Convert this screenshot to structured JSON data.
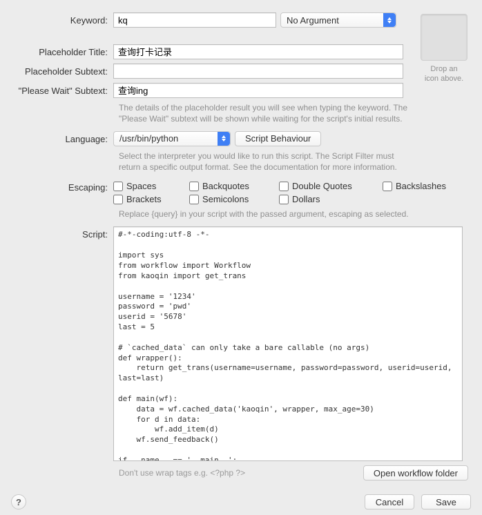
{
  "labels": {
    "keyword": "Keyword:",
    "placeholderTitle": "Placeholder Title:",
    "placeholderSubtext": "Placeholder Subtext:",
    "pleaseWaitSubtext": "\"Please Wait\" Subtext:",
    "language": "Language:",
    "escaping": "Escaping:",
    "script": "Script:"
  },
  "fields": {
    "keyword": "kq",
    "argument": "No Argument",
    "placeholderTitle": "查询打卡记录",
    "placeholderSubtext": "",
    "pleaseWaitSubtext": "查询ing",
    "language": "/usr/bin/python"
  },
  "hints": {
    "placeholder": "The details of the placeholder result you will see when typing the keyword. The \"Please Wait\" subtext will be shown while waiting for the script's initial results.",
    "language": "Select the interpreter you would like to run this script. The Script Filter must return a specific output format. See the documentation for more information.",
    "escaping": "Replace {query} in your script with the passed argument, escaping as selected.",
    "scriptFooter": "Don't use wrap tags e.g. <?php ?>"
  },
  "iconWell": {
    "line1": "Drop an",
    "line2": "icon above."
  },
  "escaping": {
    "spaces": {
      "label": "Spaces",
      "checked": false
    },
    "backquotes": {
      "label": "Backquotes",
      "checked": false
    },
    "doubleQuotes": {
      "label": "Double Quotes",
      "checked": false
    },
    "backslashes": {
      "label": "Backslashes",
      "checked": false
    },
    "brackets": {
      "label": "Brackets",
      "checked": false
    },
    "semicolons": {
      "label": "Semicolons",
      "checked": false
    },
    "dollars": {
      "label": "Dollars",
      "checked": false
    }
  },
  "buttons": {
    "scriptBehaviour": "Script Behaviour",
    "openWorkflowFolder": "Open workflow folder",
    "cancel": "Cancel",
    "save": "Save",
    "help": "?"
  },
  "script": "#-*-coding:utf-8 -*-\n\nimport sys\nfrom workflow import Workflow\nfrom kaoqin import get_trans\n\nusername = '1234'\npassword = 'pwd'\nuserid = '5678'\nlast = 5\n\n# `cached_data` can only take a bare callable (no args)\ndef wrapper():\n    return get_trans(username=username, password=password, userid=userid, last=last)\n\ndef main(wf):\n    data = wf.cached_data('kaoqin', wrapper, max_age=30)\n    for d in data:\n        wf.add_item(d)\n    wf.send_feedback()\n\nif __name__ == '__main__':\n    wf = Workflow()\n    sys.exit(wf.run(main))"
}
